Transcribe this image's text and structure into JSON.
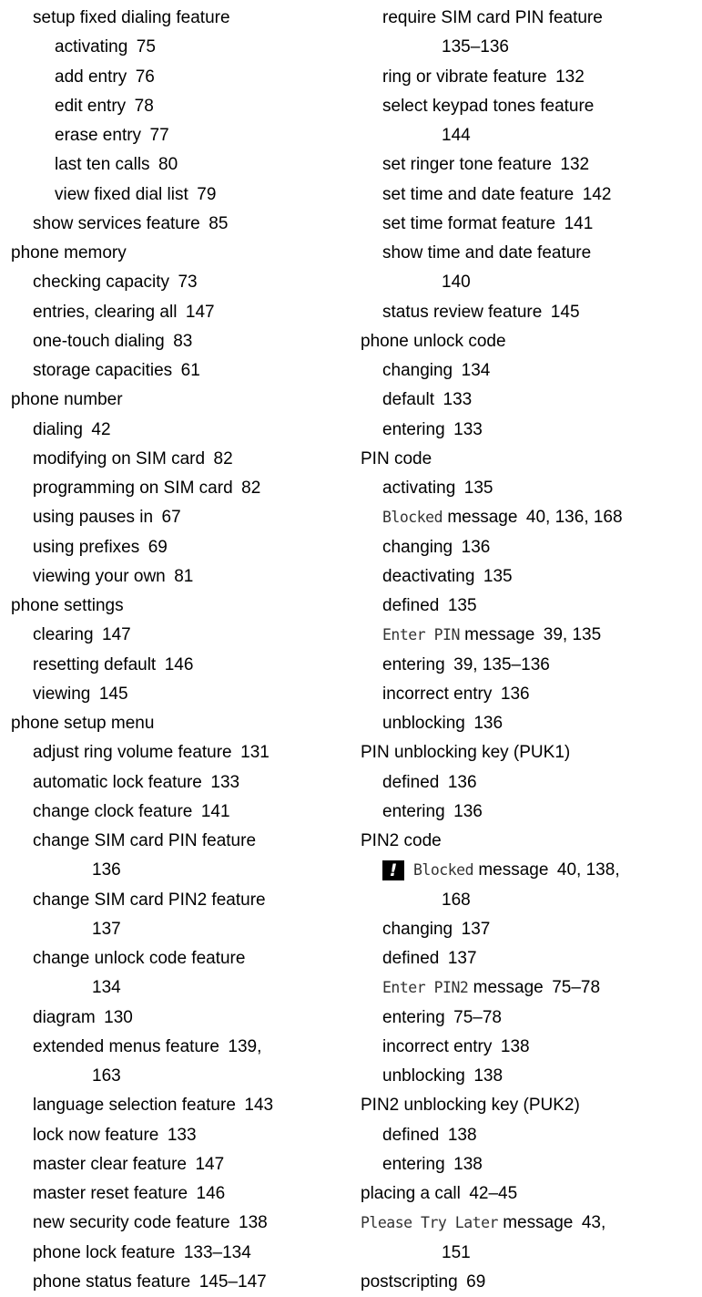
{
  "left_column": [
    {
      "level": 1,
      "text": "setup fixed dialing feature"
    },
    {
      "level": 2,
      "text": "activating  75"
    },
    {
      "level": 2,
      "text": "add entry  76"
    },
    {
      "level": 2,
      "text": "edit entry  78"
    },
    {
      "level": 2,
      "text": "erase entry  77"
    },
    {
      "level": 2,
      "text": "last ten calls  80"
    },
    {
      "level": 2,
      "text": "view fixed dial list  79"
    },
    {
      "level": 1,
      "text": "show services feature  85"
    },
    {
      "level": 0,
      "text": "phone memory"
    },
    {
      "level": 1,
      "text": "checking capacity  73"
    },
    {
      "level": 1,
      "text": "entries, clearing all  147"
    },
    {
      "level": 1,
      "text": "one-touch dialing  83"
    },
    {
      "level": 1,
      "text": "storage capacities  61"
    },
    {
      "level": 0,
      "text": "phone number"
    },
    {
      "level": 1,
      "text": "dialing  42"
    },
    {
      "level": 1,
      "text": "modifying on SIM card  82"
    },
    {
      "level": 1,
      "text": "programming on SIM card  82"
    },
    {
      "level": 1,
      "text": "using pauses in  67"
    },
    {
      "level": 1,
      "text": "using prefixes  69"
    },
    {
      "level": 1,
      "text": "viewing your own  81"
    },
    {
      "level": 0,
      "text": "phone settings"
    },
    {
      "level": 1,
      "text": "clearing  147"
    },
    {
      "level": 1,
      "text": "resetting default  146"
    },
    {
      "level": 1,
      "text": "viewing  145"
    },
    {
      "level": 0,
      "text": "phone setup menu"
    },
    {
      "level": 1,
      "text": "adjust ring volume feature  131"
    },
    {
      "level": 1,
      "text": "automatic lock feature  133"
    },
    {
      "level": 1,
      "text": "change clock feature  141"
    },
    {
      "level": 1,
      "text": "change SIM card PIN feature"
    },
    {
      "level": 3,
      "text": "136"
    },
    {
      "level": 1,
      "text": "change SIM card PIN2 feature"
    },
    {
      "level": 3,
      "text": "137"
    },
    {
      "level": 1,
      "text": "change unlock code feature"
    },
    {
      "level": 3,
      "text": "134"
    },
    {
      "level": 1,
      "text": "diagram  130"
    },
    {
      "level": 1,
      "text": "extended menus feature  139,"
    },
    {
      "level": 3,
      "text": "163"
    },
    {
      "level": 1,
      "text": "language selection feature  143"
    },
    {
      "level": 1,
      "text": "lock now feature  133"
    },
    {
      "level": 1,
      "text": "master clear feature  147"
    },
    {
      "level": 1,
      "text": "master reset feature  146"
    },
    {
      "level": 1,
      "text": "new security code feature  138"
    },
    {
      "level": 1,
      "text": "phone lock feature  133–134"
    },
    {
      "level": 1,
      "text": "phone status feature  145–147"
    }
  ],
  "right_column": [
    {
      "level": 1,
      "text": "require SIM card PIN feature"
    },
    {
      "level": 3,
      "text": "135–136"
    },
    {
      "level": 1,
      "text": "ring or vibrate feature  132"
    },
    {
      "level": 1,
      "text": "select keypad tones feature"
    },
    {
      "level": 3,
      "text": "144"
    },
    {
      "level": 1,
      "text": "set ringer tone feature  132"
    },
    {
      "level": 1,
      "text": "set time and date feature  142"
    },
    {
      "level": 1,
      "text": "set time format feature  141"
    },
    {
      "level": 1,
      "text": "show time and date feature"
    },
    {
      "level": 3,
      "text": "140"
    },
    {
      "level": 1,
      "text": "status review feature  145"
    },
    {
      "level": 0,
      "text": "phone unlock code"
    },
    {
      "level": 1,
      "text": "changing  134"
    },
    {
      "level": 1,
      "text": "default  133"
    },
    {
      "level": 1,
      "text": "entering  133"
    },
    {
      "level": 0,
      "text": "PIN code"
    },
    {
      "level": 1,
      "text": "activating  135"
    },
    {
      "level": 1,
      "mono": "Blocked",
      "text": " message  40, 136, 168"
    },
    {
      "level": 1,
      "text": "changing  136"
    },
    {
      "level": 1,
      "text": "deactivating  135"
    },
    {
      "level": 1,
      "text": "defined  135"
    },
    {
      "level": 1,
      "mono": "Enter PIN",
      "text": " message  39, 135"
    },
    {
      "level": 1,
      "text": "entering  39, 135–136"
    },
    {
      "level": 1,
      "text": "incorrect entry  136"
    },
    {
      "level": 1,
      "text": "unblocking  136"
    },
    {
      "level": 0,
      "text": "PIN unblocking key (PUK1)"
    },
    {
      "level": 1,
      "text": "defined  136"
    },
    {
      "level": 1,
      "text": "entering  136"
    },
    {
      "level": 0,
      "text": "PIN2 code"
    },
    {
      "level": 1,
      "warn": "!",
      "mono": "Blocked",
      "text": " message  40, 138,"
    },
    {
      "level": 3,
      "text": "168"
    },
    {
      "level": 1,
      "text": "changing  137"
    },
    {
      "level": 1,
      "text": "defined  137"
    },
    {
      "level": 1,
      "mono": "Enter PIN2",
      "text": " message  75–78"
    },
    {
      "level": 1,
      "text": "entering  75–78"
    },
    {
      "level": 1,
      "text": "incorrect entry  138"
    },
    {
      "level": 1,
      "text": "unblocking  138"
    },
    {
      "level": 0,
      "text": "PIN2 unblocking key (PUK2)"
    },
    {
      "level": 1,
      "text": "defined  138"
    },
    {
      "level": 1,
      "text": "entering  138"
    },
    {
      "level": 0,
      "text": "placing a call  42–45"
    },
    {
      "level": 0,
      "mono": "Please Try Later",
      "text": " message  43,"
    },
    {
      "level": 3,
      "text": "151"
    },
    {
      "level": 0,
      "text": "postscripting  69"
    }
  ]
}
